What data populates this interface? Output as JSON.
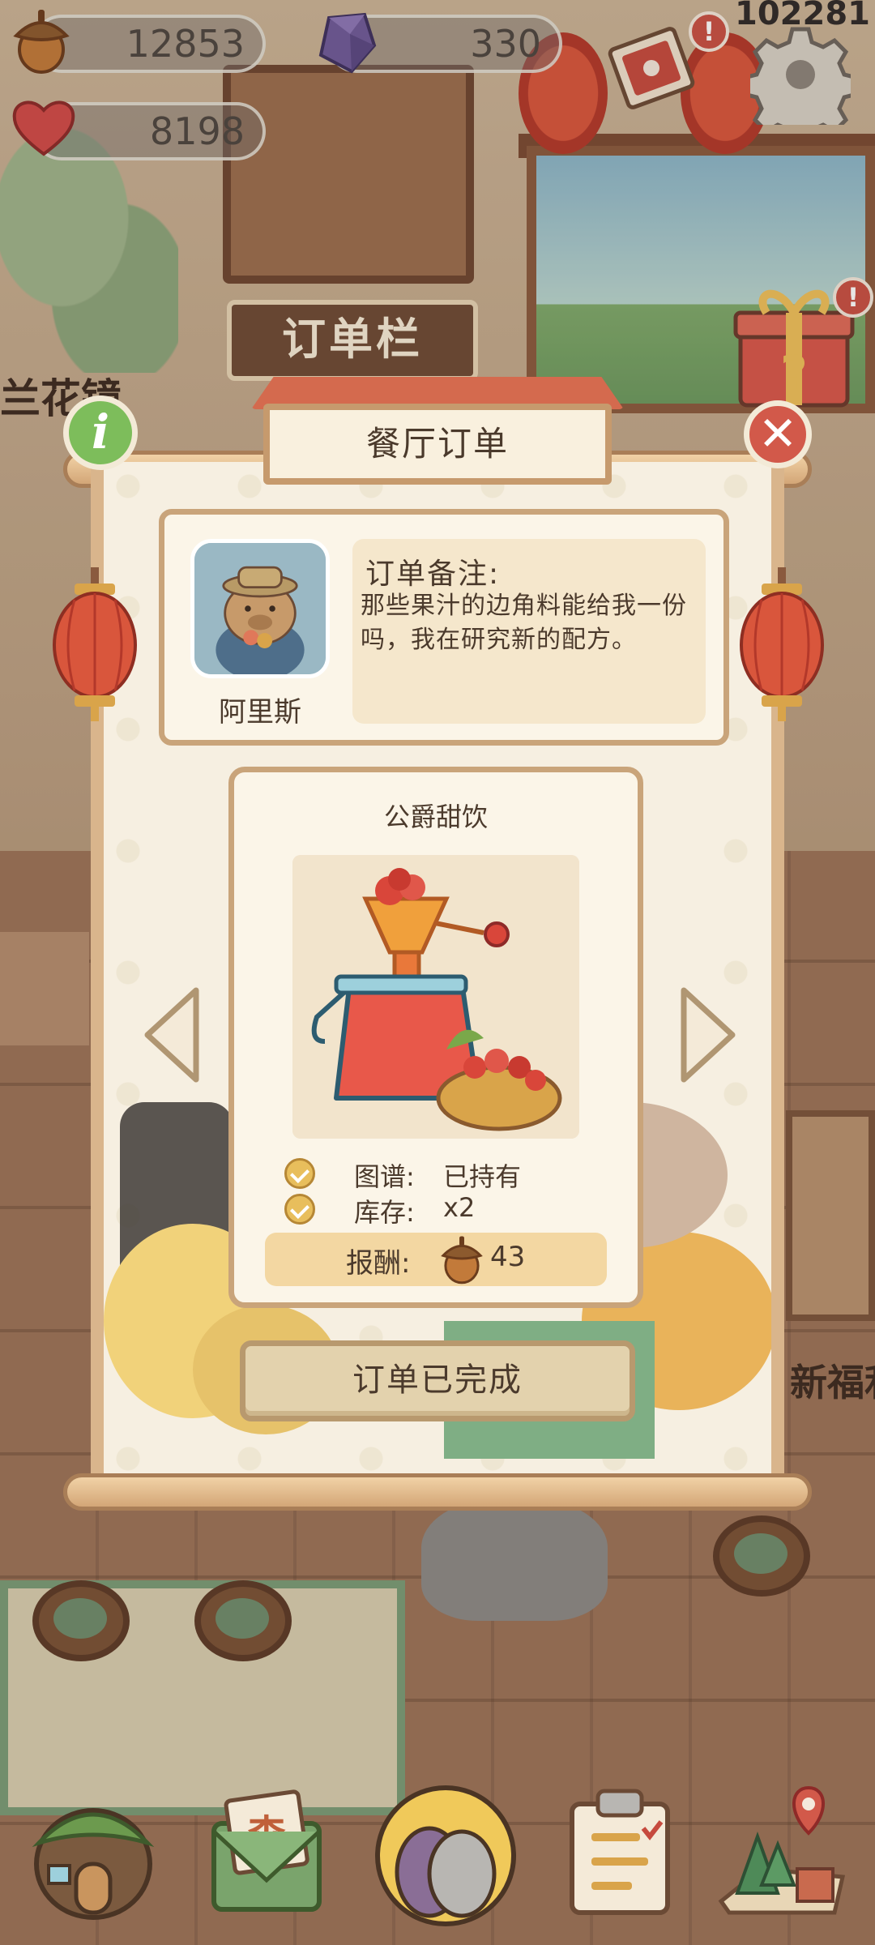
{
  "hud": {
    "acorns": "12853",
    "gems": "330",
    "hearts": "8198",
    "player_id": "102281"
  },
  "background": {
    "order_board_sign": "订单栏",
    "flower_shop_sign": "兰花镜",
    "right_shop_sign": "新福利"
  },
  "modal": {
    "title": "餐厅订单",
    "customer": {
      "name": "阿里斯",
      "note_title": "订单备注:",
      "note_text": "那些果汁的边角料能给我一份吗，我在研究新的配方。"
    },
    "dish": {
      "name": "公爵甜饮",
      "recipe_label": "图谱:",
      "recipe_value": "已持有",
      "stock_label": "库存:",
      "stock_value": "x2",
      "reward_label": "报酬:",
      "reward_value": "43"
    },
    "complete_button": "订单已完成"
  },
  "colors": {
    "accent_red": "#d2594a",
    "info_green": "#7dbd5b",
    "wood": "#c9a47a",
    "paper": "#fbf5e8"
  },
  "icons": [
    "acorn-icon",
    "gem-icon",
    "heart-icon",
    "gift-box-icon",
    "settings-gear-icon",
    "letter-icon",
    "info-icon",
    "close-icon",
    "chevron-left-icon",
    "chevron-right-icon",
    "house-icon",
    "mail-icon",
    "character-icon",
    "clipboard-icon",
    "map-icon"
  ]
}
